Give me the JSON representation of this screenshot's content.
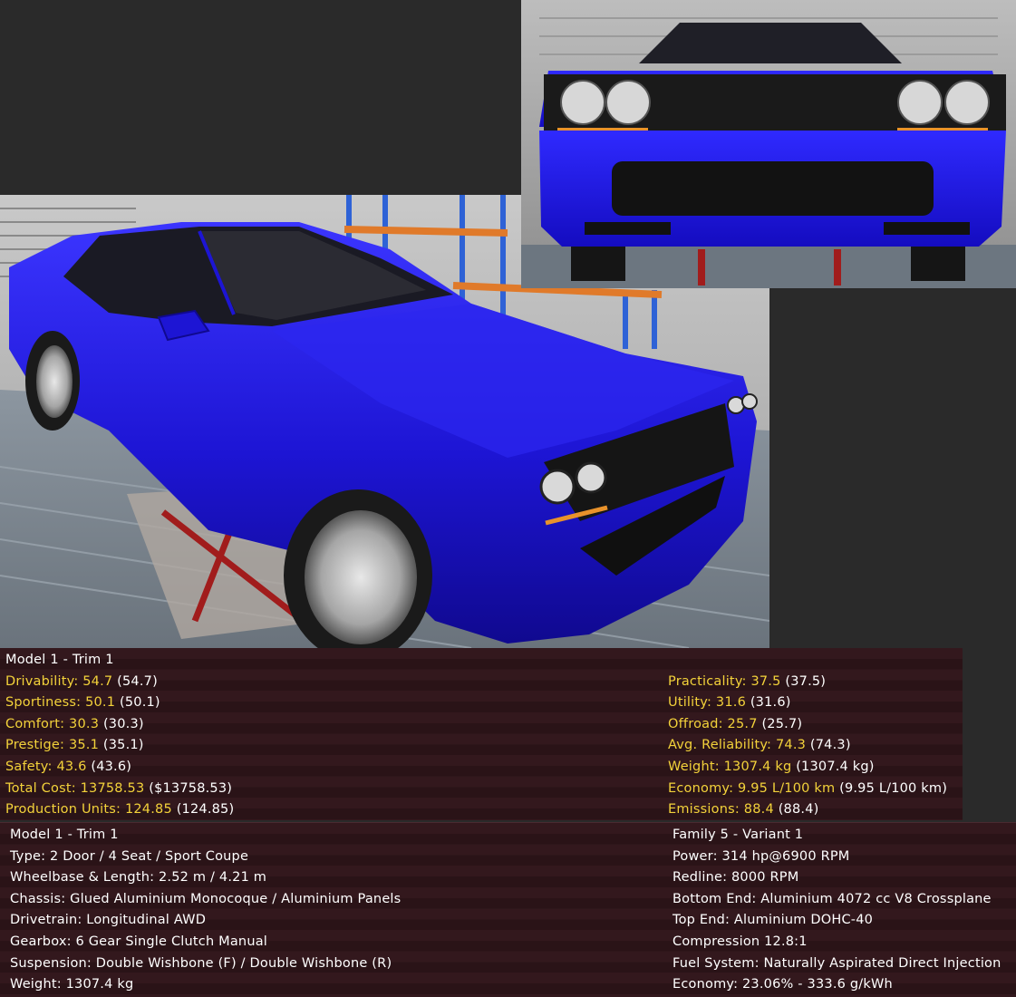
{
  "stats": {
    "title": "Model 1 - Trim 1",
    "left": [
      {
        "label": "Drivability:",
        "value": "54.7",
        "paren": "(54.7)"
      },
      {
        "label": "Sportiness:",
        "value": "50.1",
        "paren": "(50.1)"
      },
      {
        "label": "Comfort:",
        "value": "30.3",
        "paren": "(30.3)"
      },
      {
        "label": "Prestige:",
        "value": "35.1",
        "paren": "(35.1)"
      },
      {
        "label": "Safety:",
        "value": "43.6",
        "paren": "(43.6)"
      },
      {
        "label": "Total Cost:",
        "value": "13758.53",
        "paren": "($13758.53)"
      },
      {
        "label": "Production Units:",
        "value": "124.85",
        "paren": "(124.85)"
      }
    ],
    "right": [
      {
        "label": "Practicality:",
        "value": "37.5",
        "paren": "(37.5)"
      },
      {
        "label": "Utility:",
        "value": "31.6",
        "paren": "(31.6)"
      },
      {
        "label": "Offroad:",
        "value": "25.7",
        "paren": "(25.7)"
      },
      {
        "label": "Avg. Reliability:",
        "value": "74.3",
        "paren": "(74.3)"
      },
      {
        "label": "Weight:",
        "value": "1307.4 kg",
        "paren": "(1307.4 kg)"
      },
      {
        "label": "Economy:",
        "value": "9.95 L/100 km",
        "paren": "(9.95 L/100 km)"
      },
      {
        "label": "Emissions:",
        "value": "88.4",
        "paren": "(88.4)"
      }
    ]
  },
  "details": {
    "left": [
      "Model 1 - Trim 1",
      "Type: 2 Door / 4 Seat / Sport Coupe",
      "Wheelbase & Length: 2.52 m / 4.21 m",
      "Chassis: Glued Aluminium Monocoque / Aluminium Panels",
      "Drivetrain: Longitudinal AWD",
      "Gearbox: 6 Gear Single Clutch Manual",
      "Suspension: Double Wishbone (F) / Double Wishbone (R)",
      "Weight: 1307.4 kg"
    ],
    "right": [
      "Family 5 - Variant 1",
      "Power: 314 hp@6900 RPM",
      "Redline: 8000 RPM",
      "Bottom End: Aluminium 4072 cc V8 Crossplane",
      "Top End: Aluminium DOHC-40",
      "Compression 12.8:1",
      "Fuel System: Naturally Aspirated Direct Injection",
      "Economy: 23.06% - 333.6 g/kWh"
    ]
  },
  "colors": {
    "car_body": "#1e16d8",
    "highlight": "#f3d23a",
    "panel_bg": "#33181d",
    "empty_bg": "#2a2a2a"
  }
}
